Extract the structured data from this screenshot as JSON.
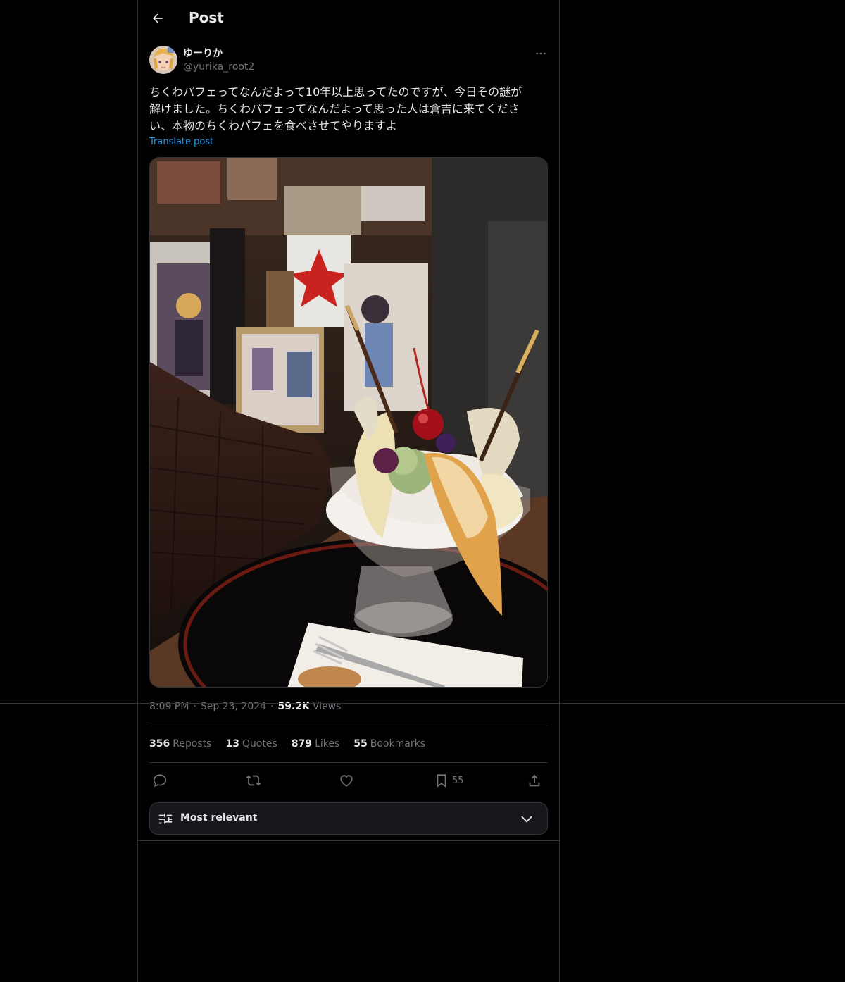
{
  "header": {
    "title": "Post",
    "back_icon": "arrow-left-icon"
  },
  "author": {
    "display_name": "ゆーりか",
    "handle": "@yurika_root2"
  },
  "post": {
    "text": "ちくわパフェってなんだよって10年以上思ってたのですが、今日その謎が\n解けました。ちくわパフェってなんだよって思った人は倉吉に来てくださ\nい、本物のちくわパフェを食べさせてやりますよ",
    "translate_label": "Translate post"
  },
  "meta": {
    "time": "8:09 PM",
    "date": "Sep 23, 2024",
    "separator": "·",
    "views_count": "59.2K",
    "views_label": "Views"
  },
  "stats": [
    {
      "count": "356",
      "label": "Reposts"
    },
    {
      "count": "13",
      "label": "Quotes"
    },
    {
      "count": "879",
      "label": "Likes"
    },
    {
      "count": "55",
      "label": "Bookmarks"
    }
  ],
  "actions": {
    "bookmark_count": "55"
  },
  "sort": {
    "label": "Most relevant"
  },
  "colors": {
    "background": "#000000",
    "border": "#2f3336",
    "text": "#e7e9ea",
    "muted": "#71767b",
    "accent": "#1d9bf0"
  }
}
